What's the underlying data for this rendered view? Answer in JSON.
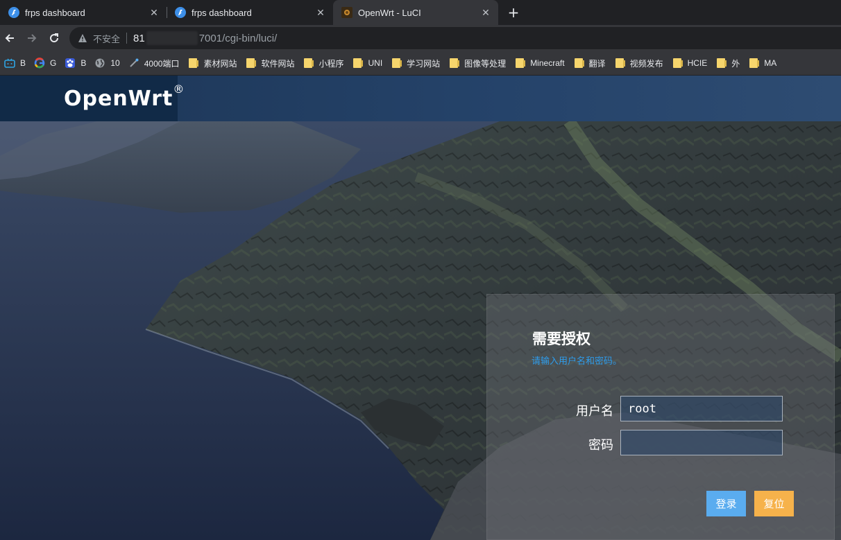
{
  "browser": {
    "tabs": [
      {
        "title": "frps dashboard",
        "icon": "frps-favicon-icon",
        "active": false
      },
      {
        "title": "frps dashboard",
        "icon": "frps-favicon-icon",
        "active": false
      },
      {
        "title": "OpenWrt - LuCI",
        "icon": "openwrt-favicon-icon",
        "active": true
      }
    ],
    "close_glyph": "✕",
    "new_tab_glyph": "+",
    "address": {
      "security_label": "不安全",
      "url_host_start": "81",
      "url_rest": "7001/cgi-bin/luci/"
    },
    "bookmarks": [
      {
        "label": "B",
        "icon": "bilibili-icon"
      },
      {
        "label": "G",
        "icon": "google-icon"
      },
      {
        "label": "B",
        "icon": "baidu-icon"
      },
      {
        "label": "10",
        "icon": "globe-icon"
      },
      {
        "label": "4000端口",
        "icon": "link-icon"
      },
      {
        "label": "素材网站",
        "icon": "folder-icon"
      },
      {
        "label": "软件网站",
        "icon": "folder-icon"
      },
      {
        "label": "小程序",
        "icon": "folder-icon"
      },
      {
        "label": "UNI",
        "icon": "folder-icon"
      },
      {
        "label": "学习网站",
        "icon": "folder-icon"
      },
      {
        "label": "图像等处理",
        "icon": "folder-icon"
      },
      {
        "label": "Minecraft",
        "icon": "folder-icon"
      },
      {
        "label": "翻译",
        "icon": "folder-icon"
      },
      {
        "label": "视频发布",
        "icon": "folder-icon"
      },
      {
        "label": "HCIE",
        "icon": "folder-icon"
      },
      {
        "label": "外",
        "icon": "folder-icon"
      },
      {
        "label": "MA",
        "icon": "folder-icon"
      }
    ]
  },
  "header": {
    "brand": "OpenWrt",
    "brand_mark": "®",
    "colors": {
      "bar": "#1c3555",
      "brand_bg": "#112a47"
    }
  },
  "login": {
    "title": "需要授权",
    "description": "请输入用户名和密码。",
    "username_label": "用户名",
    "username_value": "root",
    "password_label": "密码",
    "password_value": "",
    "login_button": "登录",
    "reset_button": "复位",
    "colors": {
      "login": "#5aacef",
      "reset": "#f6b24b",
      "description": "#2e9bea"
    }
  }
}
